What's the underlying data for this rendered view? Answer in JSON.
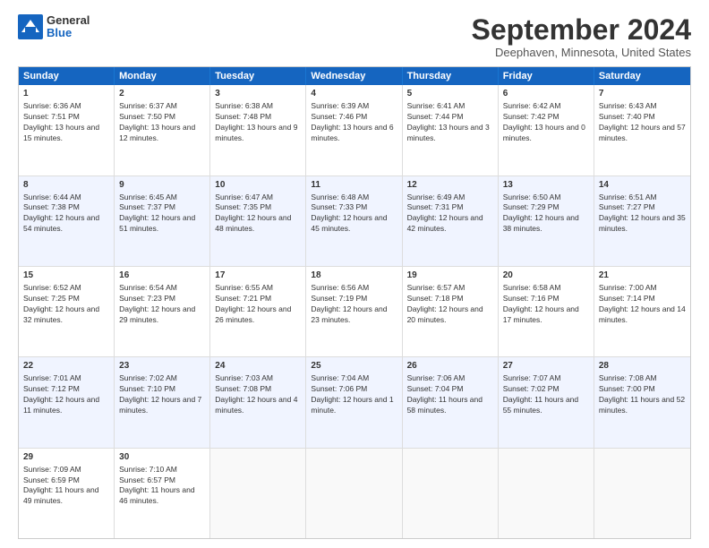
{
  "logo": {
    "general": "General",
    "blue": "Blue"
  },
  "title": "September 2024",
  "location": "Deephaven, Minnesota, United States",
  "header_days": [
    "Sunday",
    "Monday",
    "Tuesday",
    "Wednesday",
    "Thursday",
    "Friday",
    "Saturday"
  ],
  "weeks": [
    [
      {
        "day": "1",
        "sunrise": "Sunrise: 6:36 AM",
        "sunset": "Sunset: 7:51 PM",
        "daylight": "Daylight: 13 hours and 15 minutes."
      },
      {
        "day": "2",
        "sunrise": "Sunrise: 6:37 AM",
        "sunset": "Sunset: 7:50 PM",
        "daylight": "Daylight: 13 hours and 12 minutes."
      },
      {
        "day": "3",
        "sunrise": "Sunrise: 6:38 AM",
        "sunset": "Sunset: 7:48 PM",
        "daylight": "Daylight: 13 hours and 9 minutes."
      },
      {
        "day": "4",
        "sunrise": "Sunrise: 6:39 AM",
        "sunset": "Sunset: 7:46 PM",
        "daylight": "Daylight: 13 hours and 6 minutes."
      },
      {
        "day": "5",
        "sunrise": "Sunrise: 6:41 AM",
        "sunset": "Sunset: 7:44 PM",
        "daylight": "Daylight: 13 hours and 3 minutes."
      },
      {
        "day": "6",
        "sunrise": "Sunrise: 6:42 AM",
        "sunset": "Sunset: 7:42 PM",
        "daylight": "Daylight: 13 hours and 0 minutes."
      },
      {
        "day": "7",
        "sunrise": "Sunrise: 6:43 AM",
        "sunset": "Sunset: 7:40 PM",
        "daylight": "Daylight: 12 hours and 57 minutes."
      }
    ],
    [
      {
        "day": "8",
        "sunrise": "Sunrise: 6:44 AM",
        "sunset": "Sunset: 7:38 PM",
        "daylight": "Daylight: 12 hours and 54 minutes."
      },
      {
        "day": "9",
        "sunrise": "Sunrise: 6:45 AM",
        "sunset": "Sunset: 7:37 PM",
        "daylight": "Daylight: 12 hours and 51 minutes."
      },
      {
        "day": "10",
        "sunrise": "Sunrise: 6:47 AM",
        "sunset": "Sunset: 7:35 PM",
        "daylight": "Daylight: 12 hours and 48 minutes."
      },
      {
        "day": "11",
        "sunrise": "Sunrise: 6:48 AM",
        "sunset": "Sunset: 7:33 PM",
        "daylight": "Daylight: 12 hours and 45 minutes."
      },
      {
        "day": "12",
        "sunrise": "Sunrise: 6:49 AM",
        "sunset": "Sunset: 7:31 PM",
        "daylight": "Daylight: 12 hours and 42 minutes."
      },
      {
        "day": "13",
        "sunrise": "Sunrise: 6:50 AM",
        "sunset": "Sunset: 7:29 PM",
        "daylight": "Daylight: 12 hours and 38 minutes."
      },
      {
        "day": "14",
        "sunrise": "Sunrise: 6:51 AM",
        "sunset": "Sunset: 7:27 PM",
        "daylight": "Daylight: 12 hours and 35 minutes."
      }
    ],
    [
      {
        "day": "15",
        "sunrise": "Sunrise: 6:52 AM",
        "sunset": "Sunset: 7:25 PM",
        "daylight": "Daylight: 12 hours and 32 minutes."
      },
      {
        "day": "16",
        "sunrise": "Sunrise: 6:54 AM",
        "sunset": "Sunset: 7:23 PM",
        "daylight": "Daylight: 12 hours and 29 minutes."
      },
      {
        "day": "17",
        "sunrise": "Sunrise: 6:55 AM",
        "sunset": "Sunset: 7:21 PM",
        "daylight": "Daylight: 12 hours and 26 minutes."
      },
      {
        "day": "18",
        "sunrise": "Sunrise: 6:56 AM",
        "sunset": "Sunset: 7:19 PM",
        "daylight": "Daylight: 12 hours and 23 minutes."
      },
      {
        "day": "19",
        "sunrise": "Sunrise: 6:57 AM",
        "sunset": "Sunset: 7:18 PM",
        "daylight": "Daylight: 12 hours and 20 minutes."
      },
      {
        "day": "20",
        "sunrise": "Sunrise: 6:58 AM",
        "sunset": "Sunset: 7:16 PM",
        "daylight": "Daylight: 12 hours and 17 minutes."
      },
      {
        "day": "21",
        "sunrise": "Sunrise: 7:00 AM",
        "sunset": "Sunset: 7:14 PM",
        "daylight": "Daylight: 12 hours and 14 minutes."
      }
    ],
    [
      {
        "day": "22",
        "sunrise": "Sunrise: 7:01 AM",
        "sunset": "Sunset: 7:12 PM",
        "daylight": "Daylight: 12 hours and 11 minutes."
      },
      {
        "day": "23",
        "sunrise": "Sunrise: 7:02 AM",
        "sunset": "Sunset: 7:10 PM",
        "daylight": "Daylight: 12 hours and 7 minutes."
      },
      {
        "day": "24",
        "sunrise": "Sunrise: 7:03 AM",
        "sunset": "Sunset: 7:08 PM",
        "daylight": "Daylight: 12 hours and 4 minutes."
      },
      {
        "day": "25",
        "sunrise": "Sunrise: 7:04 AM",
        "sunset": "Sunset: 7:06 PM",
        "daylight": "Daylight: 12 hours and 1 minute."
      },
      {
        "day": "26",
        "sunrise": "Sunrise: 7:06 AM",
        "sunset": "Sunset: 7:04 PM",
        "daylight": "Daylight: 11 hours and 58 minutes."
      },
      {
        "day": "27",
        "sunrise": "Sunrise: 7:07 AM",
        "sunset": "Sunset: 7:02 PM",
        "daylight": "Daylight: 11 hours and 55 minutes."
      },
      {
        "day": "28",
        "sunrise": "Sunrise: 7:08 AM",
        "sunset": "Sunset: 7:00 PM",
        "daylight": "Daylight: 11 hours and 52 minutes."
      }
    ],
    [
      {
        "day": "29",
        "sunrise": "Sunrise: 7:09 AM",
        "sunset": "Sunset: 6:59 PM",
        "daylight": "Daylight: 11 hours and 49 minutes."
      },
      {
        "day": "30",
        "sunrise": "Sunrise: 7:10 AM",
        "sunset": "Sunset: 6:57 PM",
        "daylight": "Daylight: 11 hours and 46 minutes."
      },
      {
        "day": "",
        "sunrise": "",
        "sunset": "",
        "daylight": ""
      },
      {
        "day": "",
        "sunrise": "",
        "sunset": "",
        "daylight": ""
      },
      {
        "day": "",
        "sunrise": "",
        "sunset": "",
        "daylight": ""
      },
      {
        "day": "",
        "sunrise": "",
        "sunset": "",
        "daylight": ""
      },
      {
        "day": "",
        "sunrise": "",
        "sunset": "",
        "daylight": ""
      }
    ]
  ]
}
